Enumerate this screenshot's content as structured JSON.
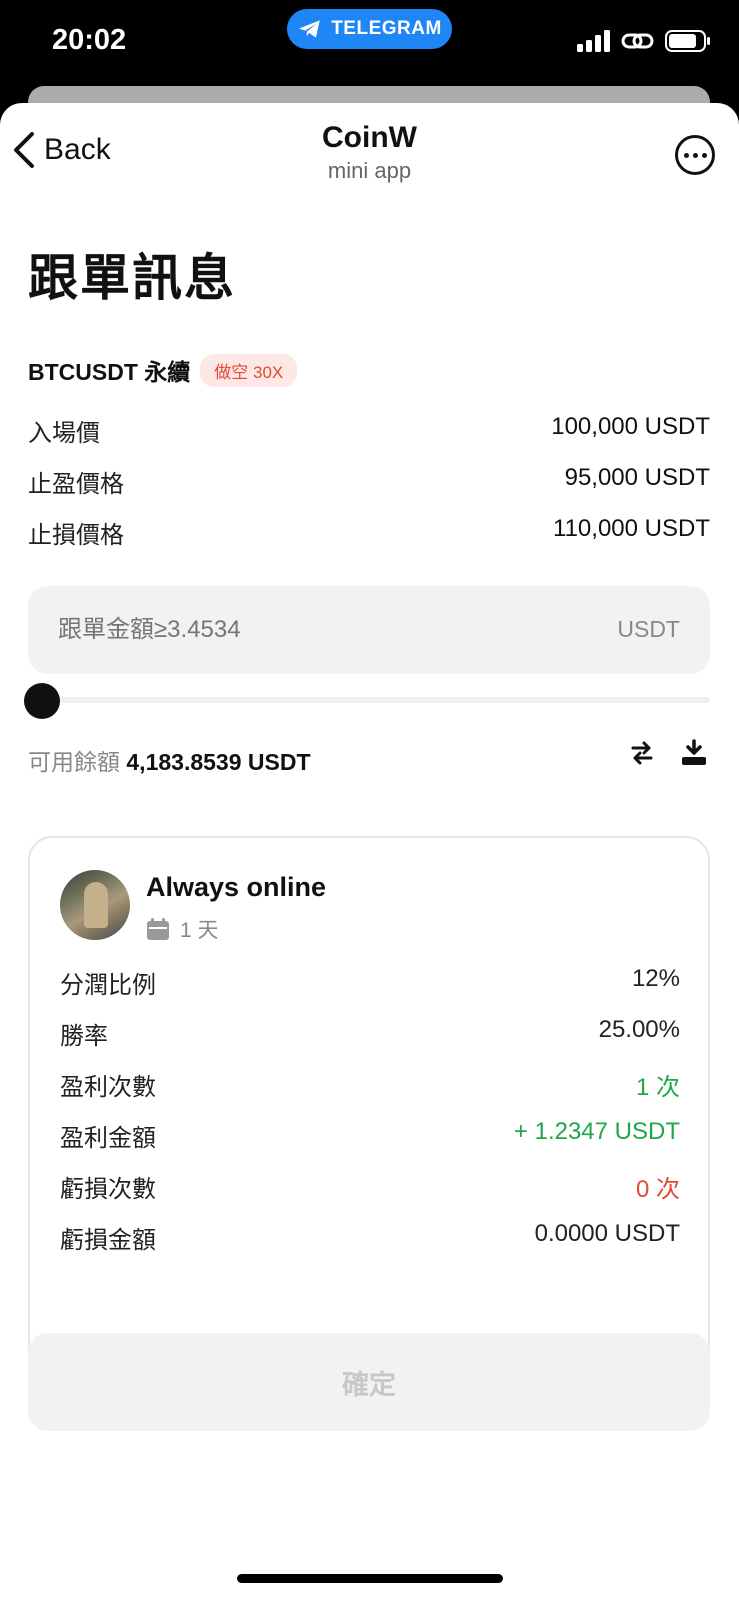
{
  "status_bar": {
    "time": "20:02",
    "pill_label": "TELEGRAM",
    "icons": [
      "signal-icon",
      "link-icon",
      "battery-icon"
    ]
  },
  "nav": {
    "back_label": "Back",
    "title": "CoinW",
    "subtitle": "mini app",
    "more_icon": "more-icon"
  },
  "page": {
    "title": "跟單訊息",
    "pair": "BTCUSDT 永續",
    "tag": "做空 30X",
    "details": [
      {
        "label": "入場價",
        "value": "100,000 USDT"
      },
      {
        "label": "止盈價格",
        "value": "95,000 USDT"
      },
      {
        "label": "止損價格",
        "value": "110,000 USDT"
      }
    ],
    "amount_placeholder": "跟單金額≥3.4534",
    "amount_unit": "USDT",
    "slider_value_percent": 0,
    "balance_label": "可用餘額",
    "balance_value": "4,183.8539 USDT"
  },
  "trader": {
    "name": "Always online",
    "days": "1 天",
    "stats": [
      {
        "label": "分潤比例",
        "value": "12%",
        "color": "#111111"
      },
      {
        "label": "勝率",
        "value": "25.00%",
        "color": "#111111"
      },
      {
        "label": "盈利次數",
        "value": "1 次",
        "color": "#1fa84a"
      },
      {
        "label": "盈利金額",
        "value": "+ 1.2347 USDT",
        "color": "#1fa84a"
      },
      {
        "label": "虧損次數",
        "value": "0 次",
        "color": "#e24a36"
      },
      {
        "label": "虧損金額",
        "value": "0.0000 USDT",
        "color": "#111111"
      }
    ]
  },
  "confirm_label": "確定"
}
